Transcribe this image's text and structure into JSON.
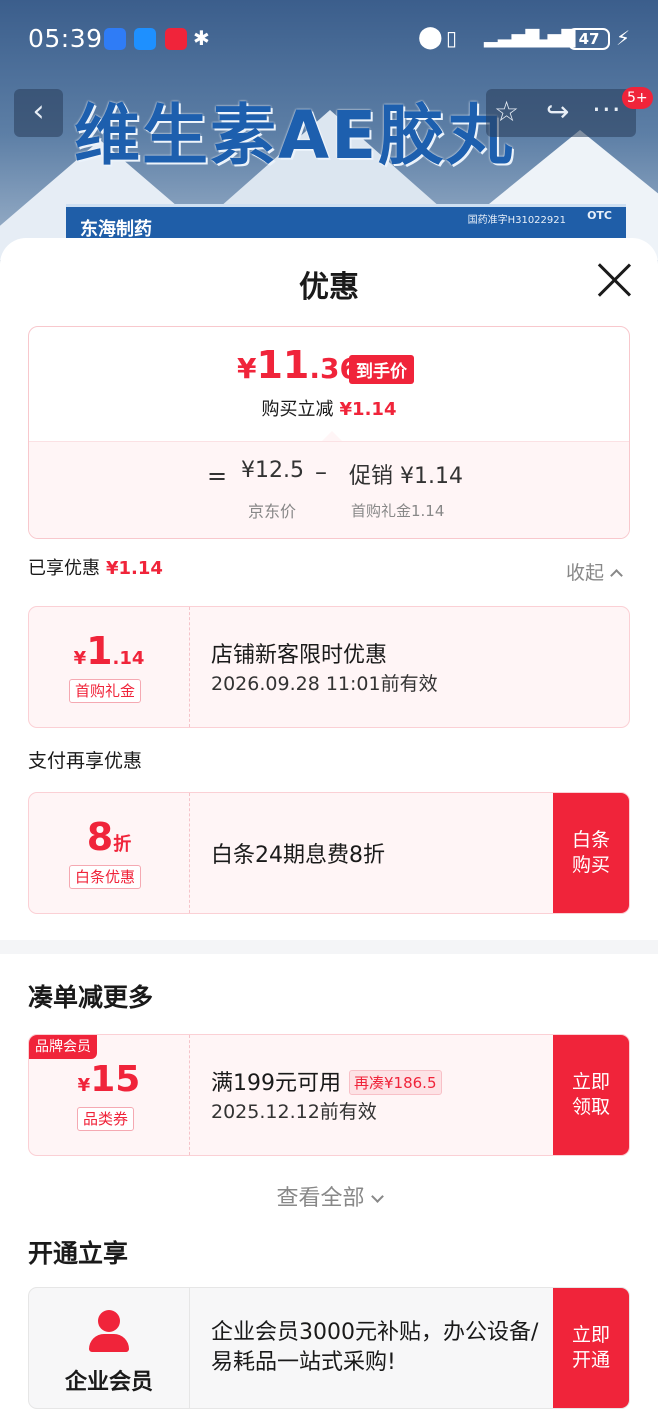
{
  "status_bar": {
    "time": "05:39",
    "battery": "47",
    "icons": [
      "app-icon-blue",
      "app-icon-compass",
      "app-icon-red",
      "bluetooth-icon",
      "location-icon",
      "vibrate-icon",
      "signal-icon",
      "signal-icon-2",
      "charging-icon"
    ]
  },
  "banner": {
    "title": "维生素AE胶丸",
    "brand": "东海制药",
    "approval": "国药准字H31022921",
    "otc": "OTC"
  },
  "top_nav": {
    "badge": "5+"
  },
  "sheet": {
    "title": "优惠",
    "final_price": {
      "currency": "¥",
      "integer": "11",
      "decimal": ".36",
      "tag": "到手价"
    },
    "reduce": {
      "label": "购买立减",
      "amount": "¥1.14"
    },
    "breakdown": {
      "equals": "=",
      "jd_price": "¥12.5",
      "jd_label": "京东价",
      "minus": "–",
      "promo": "促销 ¥1.14",
      "promo_sub": "首购礼金1.14"
    },
    "enjoyed": {
      "label": "已享优惠",
      "amount": "¥1.14",
      "collapse": "收起"
    },
    "coupon_first": {
      "currency": "¥",
      "integer": "1",
      "decimal": ".14",
      "chip": "首购礼金",
      "title": "店铺新客限时优惠",
      "validity": "2026.09.28 11:01前有效"
    },
    "pay_label": "支付再享优惠",
    "coupon_pay": {
      "integer": "8",
      "unit": "折",
      "chip": "白条优惠",
      "title": "白条24期息费8折",
      "button_line1": "白条",
      "button_line2": "购买"
    },
    "section_more": "凑单减更多",
    "coupon_brand": {
      "badge": "品牌会员",
      "currency": "¥",
      "integer": "15",
      "chip": "品类券",
      "title": "满199元可用",
      "need_more": "再凑¥186.5",
      "validity": "2025.12.12前有效",
      "button_line1": "立即",
      "button_line2": "领取"
    },
    "view_all": "查看全部",
    "section_open": "开通立享",
    "vip": {
      "name": "企业会员",
      "text": "企业会员3000元补贴，办公设备/易耗品一站式采购!",
      "button_line1": "立即",
      "button_line2": "开通"
    }
  },
  "colors": {
    "accent": "#f0243a",
    "card_bg": "#fff5f6",
    "muted": "#888888"
  }
}
